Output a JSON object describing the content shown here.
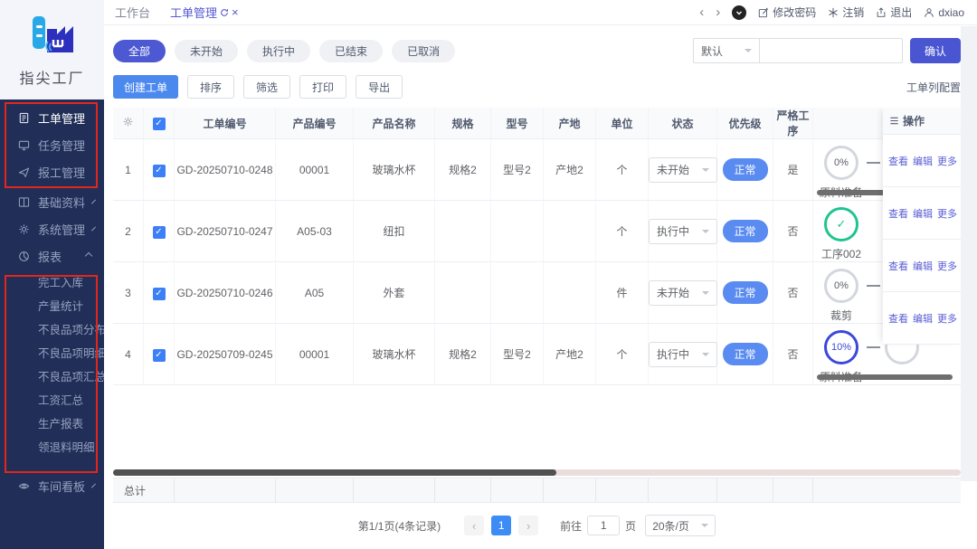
{
  "app": {
    "logo_text": "指尖工厂"
  },
  "topbar": {
    "tabs": {
      "workbench": "工作台",
      "work_order": "工单管理"
    },
    "actions": {
      "change_password": "修改密码",
      "logout": "注销",
      "exit": "退出",
      "username": "dxiao"
    }
  },
  "sidebar": {
    "items": [
      {
        "label": "工单管理"
      },
      {
        "label": "任务管理"
      },
      {
        "label": "报工管理"
      },
      {
        "label": "基础资料"
      },
      {
        "label": "系统管理"
      },
      {
        "label": "报表"
      }
    ],
    "report_submenu": [
      "完工入库",
      "产量统计",
      "不良品项分布",
      "不良品项明细",
      "不良品项汇总",
      "工资汇总",
      "生产报表",
      "领退料明细"
    ],
    "workshop_board": "车间看板"
  },
  "filters": {
    "status_tabs": [
      "全部",
      "未开始",
      "执行中",
      "已结束",
      "已取消"
    ],
    "preset": "默认",
    "search_value": "",
    "confirm": "确认",
    "column_config": "工单列配置"
  },
  "toolbar": {
    "create": "创建工单",
    "sort": "排序",
    "filter": "筛选",
    "print": "打印",
    "export": "导出"
  },
  "table": {
    "headers": {
      "order_no": "工单编号",
      "product_no": "产品编号",
      "product_name": "产品名称",
      "spec": "规格",
      "model": "型号",
      "origin": "产地",
      "unit": "单位",
      "status": "状态",
      "priority": "优先级",
      "strict": "严格工序",
      "ops": "操作"
    },
    "rows": [
      {
        "index": "1",
        "order_no": "GD-20250710-0248",
        "product_no": "00001",
        "product_name": "玻璃水杯",
        "spec": "规格2",
        "model": "型号2",
        "origin": "产地2",
        "unit": "个",
        "status": "未开始",
        "priority": "正常",
        "strict": "是",
        "progress": {
          "percent": "0%",
          "step": "原料准备"
        }
      },
      {
        "index": "2",
        "order_no": "GD-20250710-0247",
        "product_no": "A05-03",
        "product_name": "纽扣",
        "spec": "",
        "model": "",
        "origin": "",
        "unit": "个",
        "status": "执行中",
        "priority": "正常",
        "strict": "否",
        "progress": {
          "percent": "",
          "step": "工序002"
        }
      },
      {
        "index": "3",
        "order_no": "GD-20250710-0246",
        "product_no": "A05",
        "product_name": "外套",
        "spec": "",
        "model": "",
        "origin": "",
        "unit": "件",
        "status": "未开始",
        "priority": "正常",
        "strict": "否",
        "progress": {
          "percent": "0%",
          "step": "裁剪"
        }
      },
      {
        "index": "4",
        "order_no": "GD-20250709-0245",
        "product_no": "00001",
        "product_name": "玻璃水杯",
        "spec": "规格2",
        "model": "型号2",
        "origin": "产地2",
        "unit": "个",
        "status": "执行中",
        "priority": "正常",
        "strict": "否",
        "progress": {
          "percent": "10%",
          "step": "原料准备"
        }
      }
    ],
    "action_labels": [
      "查看",
      "编辑",
      "更多"
    ],
    "summary_label": "总计"
  },
  "pagination": {
    "info": "第1/1页(4条记录)",
    "prev": "‹",
    "current": "1",
    "next": "›",
    "goto_label": "前往",
    "goto_value": "1",
    "page_unit": "页",
    "page_size": "20条/页"
  },
  "icons": {
    "check": "✓",
    "close": "×"
  },
  "colors": {
    "accent_indigo": "#4c59d3",
    "accent_blue": "#4c89ef",
    "badge_blue": "#598bf0",
    "sidebar_bg": "#212e57",
    "annotation_red": "#e2261d",
    "done_green": "#1ec490",
    "progress_blue": "#3c47dc"
  }
}
